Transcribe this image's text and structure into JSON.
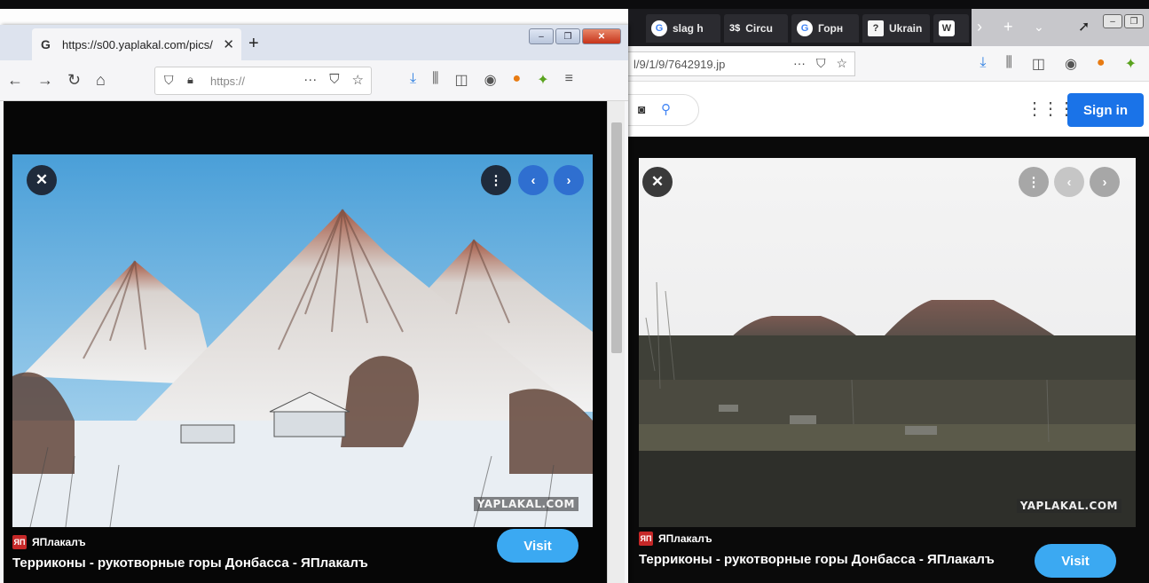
{
  "right_window": {
    "tabs": [
      {
        "label": "slag h",
        "favicon": "G"
      },
      {
        "label": "Circu",
        "favicon": "3$"
      },
      {
        "label": "Горн",
        "favicon": "G"
      },
      {
        "label": "Ukrain",
        "favicon": "?"
      },
      {
        "label": "",
        "favicon": "W"
      }
    ],
    "url_fragment": "l/9/1/9/7642919.jp",
    "signin_label": "Sign in",
    "source_name": "ЯПлакалъ",
    "title": "Терриконы - рукотворные горы Донбасса - ЯПлакалъ",
    "visit_label": "Visit",
    "watermark": "YAPLAKAL.COM"
  },
  "left_window": {
    "tab_title": "https://s00.yaplakal.com/pics/",
    "url_text": "https://",
    "source_name": "ЯПлакалъ",
    "title": "Терриконы - рукотворные горы Донбасса - ЯПлакалъ",
    "visit_label": "Visit",
    "watermark": "YAPLAKAL.COM"
  },
  "icons": {
    "back": "back-arrow-icon",
    "forward": "forward-arrow-icon",
    "reload": "reload-icon",
    "home": "home-icon",
    "download": "download-icon",
    "library": "library-icon",
    "sidebar": "sidebar-icon",
    "more": "kebab-icon"
  },
  "colors": {
    "google_blue": "#1a73e8",
    "visit_blue": "#3ba9f2",
    "firefox_close": "#c7331a"
  }
}
